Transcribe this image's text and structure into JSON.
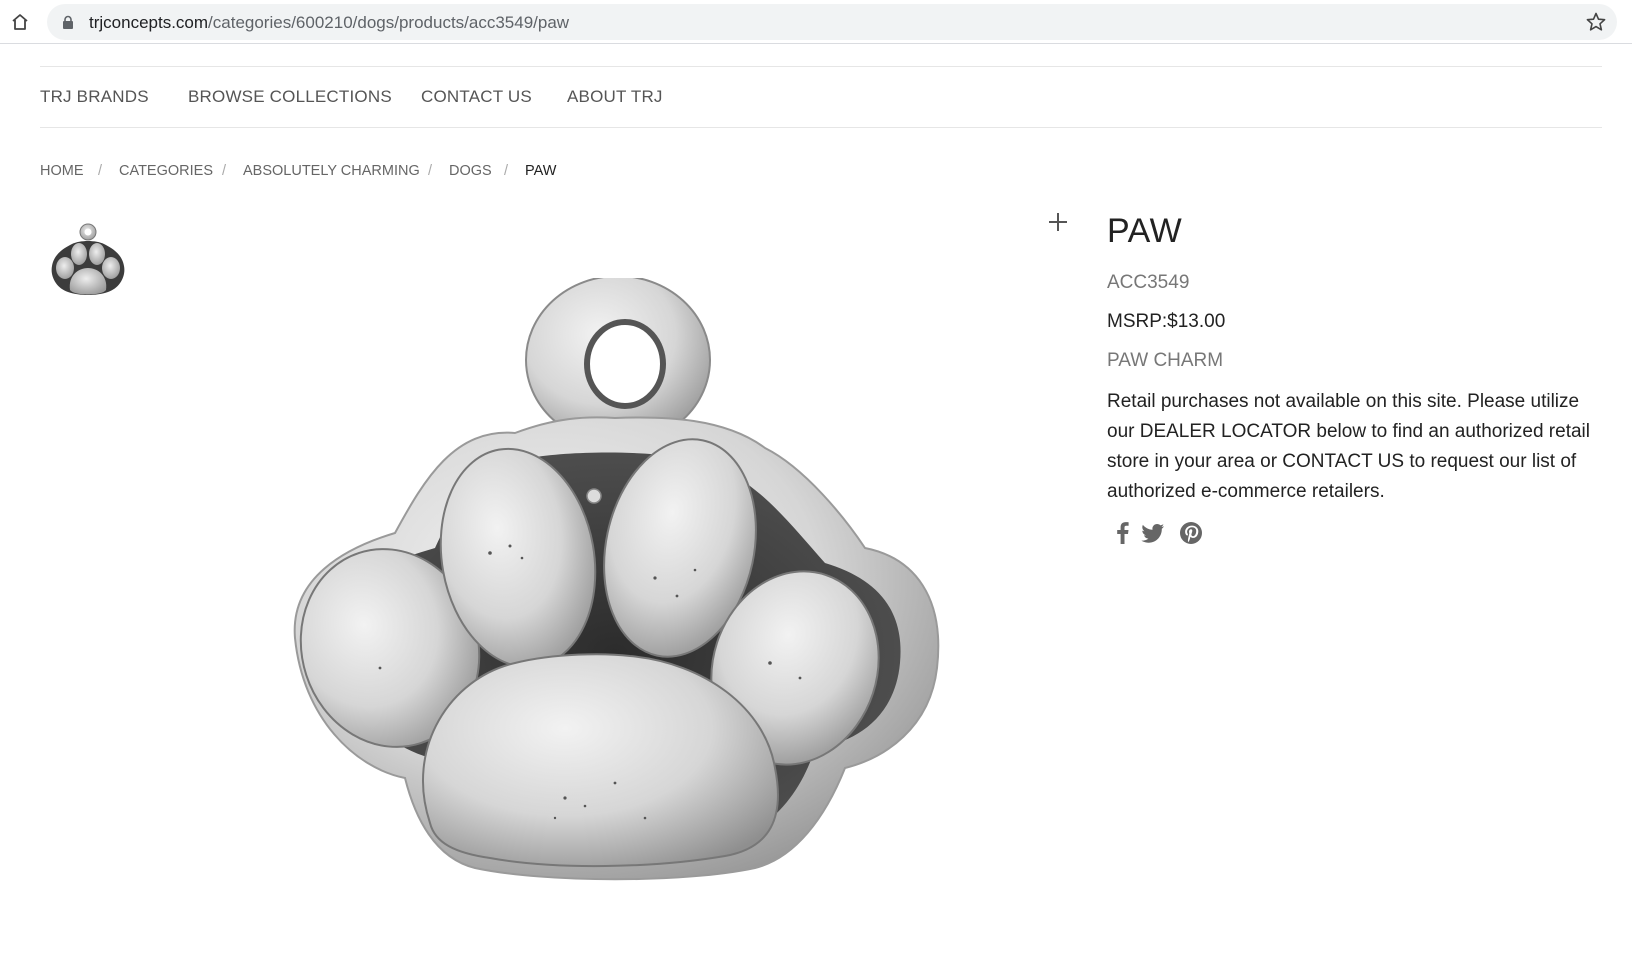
{
  "browser": {
    "url_domain": "trjconcepts.com",
    "url_path": "/categories/600210/dogs/products/acc3549/paw"
  },
  "nav": {
    "items": [
      "TRJ BRANDS",
      "BROWSE COLLECTIONS",
      "CONTACT US",
      "ABOUT TRJ"
    ]
  },
  "breadcrumb": {
    "items": [
      "HOME",
      "CATEGORIES",
      "ABSOLUTELY CHARMING",
      "DOGS",
      "PAW"
    ],
    "separator": "/"
  },
  "product": {
    "title": "PAW",
    "sku": "ACC3549",
    "price": "MSRP:$13.00",
    "subtitle": "PAW CHARM",
    "description": "Retail purchases not available on this site. Please utilize our DEALER LOCATOR below to find an authorized retail store in your area or CONTACT US to request our list of authorized e-commerce retailers."
  },
  "social": [
    "facebook-icon",
    "twitter-icon",
    "pinterest-icon"
  ],
  "colors": {
    "text": "#222222",
    "muted": "#777777",
    "icon": "#666666"
  }
}
